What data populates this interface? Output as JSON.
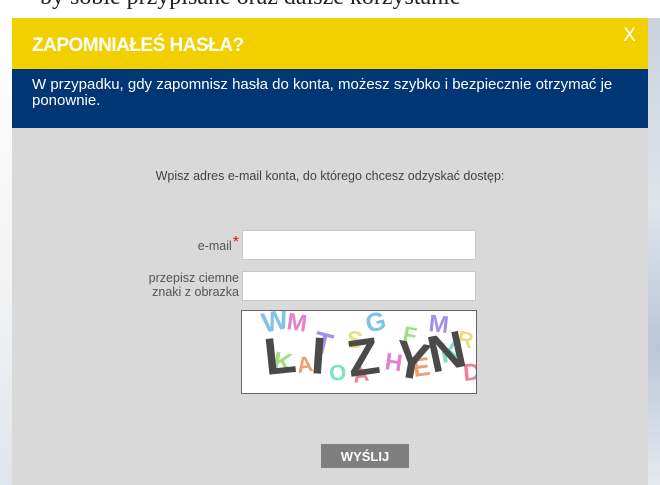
{
  "background_page": {
    "visible_text": "by sobie przypisane oraz dalsze korzystanie"
  },
  "modal": {
    "title": "ZAPOMNIAŁEŚ HASŁA?",
    "close_label": "X",
    "info_text": "W przypadku, gdy zapomnisz hasła do konta, możesz szybko i bezpiecznie otrzymać je ponownie.",
    "prompt": "Wpisz adres e-mail konta, do którego chcesz odzyskać dostęp:",
    "email_label": "e-mail",
    "required_marker": "*",
    "email_value": "",
    "captcha_label_line1": "przepisz ciemne",
    "captcha_label_line2": "znaki z obrazka",
    "captcha_value": "",
    "submit_label": "WYŚLIJ"
  },
  "captcha": {
    "dark_text": "LIZYN",
    "noise_letters": "WMKATOSAGHFEMKRD"
  },
  "colors": {
    "header_yellow": "#f2d000",
    "info_navy": "#003674",
    "modal_gray": "#d9d9d9",
    "button_gray": "#7f7f7f",
    "required_red": "#cc1f1f"
  }
}
